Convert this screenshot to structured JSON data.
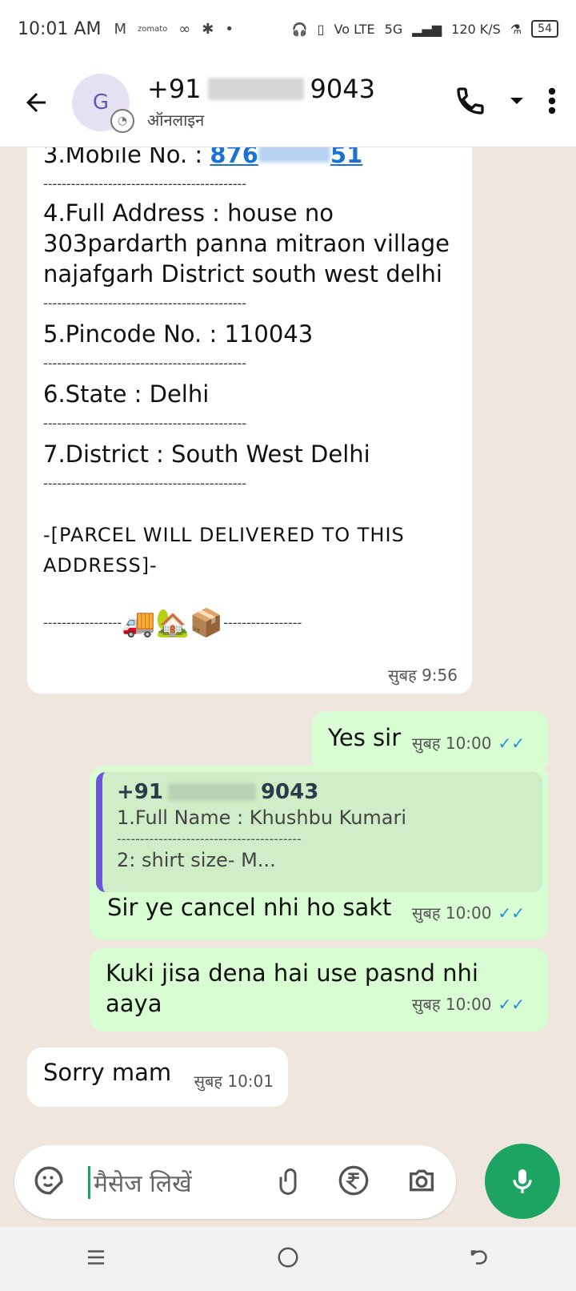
{
  "status_bar": {
    "time": "10:01 AM",
    "left_icons": [
      "gmail-icon",
      "zomato-icon",
      "glasses-icon",
      "bug-icon",
      "dot-icon"
    ],
    "network": "Vo LTE",
    "network_type": "5G",
    "speed": "120 K/S",
    "battery": "54"
  },
  "header": {
    "avatar_letter": "G",
    "contact_name_prefix": "+91",
    "contact_name_suffix": "9043",
    "status": "ऑनलाइन"
  },
  "messages": {
    "m1": {
      "mobile_label": "3.Mobile No. : ",
      "mobile_prefix": "876",
      "mobile_suffix": "51",
      "dashes": "--------------------------------------------",
      "address_1": "4.Full Address :  house no",
      "address_2": "303pardarth panna mitraon village",
      "address_3": "najafgarh District south west delhi",
      "pincode": "5.Pincode No. : 110043",
      "state": "6.State : Delhi",
      "district": "7.District : South West Delhi",
      "note_1": "-[PARCEL WILL DELIVERED TO THIS",
      "note_2": "ADDRESS]-",
      "emoji_line_left": "-----------------",
      "emoji_line_right": "-----------------",
      "emojis": "🚚🏡📦",
      "time": "सुबह 9:56"
    },
    "m2": {
      "text": "Yes sir",
      "time": "सुबह 10:00"
    },
    "m3": {
      "quote_prefix": "+91",
      "quote_suffix": "9043",
      "quote_line1": "1.Full Name : Khushbu Kumari",
      "quote_dashes": "----------------------------------------",
      "quote_line2": "2: shirt size- M...",
      "text": "Sir ye cancel nhi ho sakt",
      "time": "सुबह 10:00"
    },
    "m4": {
      "text_1": "Kuki jisa dena hai use pasnd nhi",
      "text_2": "aaya",
      "time": "सुबह 10:00"
    },
    "m5": {
      "text": "Sorry mam",
      "time": "सुबह 10:01"
    }
  },
  "input": {
    "placeholder": "मैसेज लिखें"
  },
  "colors": {
    "accent": "#1da462",
    "outgoing": "#d9fdd3",
    "incoming": "#ffffff",
    "link": "#1b73d0",
    "ticks": "#1b8cd8"
  }
}
